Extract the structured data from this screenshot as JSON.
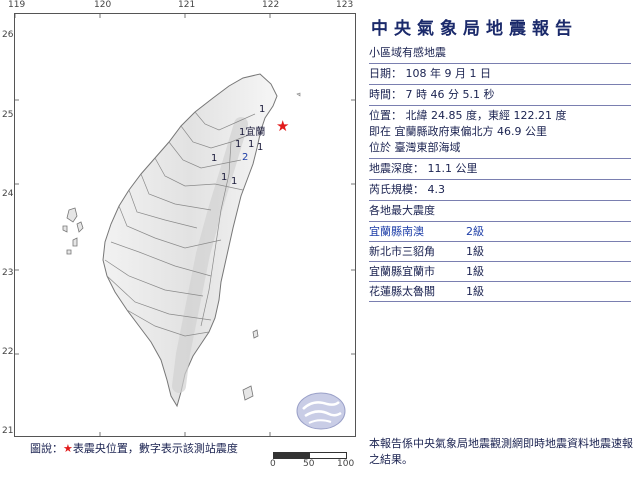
{
  "map": {
    "lon_ticks": [
      "119",
      "120",
      "121",
      "122",
      "123"
    ],
    "lat_ticks": [
      "26",
      "25",
      "24",
      "23",
      "22",
      "21"
    ],
    "epicenter_symbol": "★",
    "station_labels": [
      {
        "text": "1",
        "color": "#1a1a3a"
      },
      {
        "text": "1宜蘭",
        "color": "#1a1a3a"
      },
      {
        "text": "1",
        "color": "#1a1a3a"
      },
      {
        "text": "1",
        "color": "#1a1a3a"
      },
      {
        "text": "1",
        "color": "#1a1a3a"
      },
      {
        "text": "2",
        "color": "#1e3ea8"
      },
      {
        "text": "1",
        "color": "#1a1a3a"
      },
      {
        "text": "1",
        "color": "#1a1a3a"
      },
      {
        "text": "1",
        "color": "#1a1a3a"
      }
    ],
    "scale": {
      "unit": "km",
      "ticks": [
        "0",
        "50",
        "100"
      ]
    }
  },
  "report": {
    "title": "中央氣象局地震報告",
    "type": "小區域有感地震",
    "date": "日期：  108  年  9  月  1  日",
    "time": "時間：  7  時  46  分  5.1  秒",
    "position": "位置：  北緯  24.85  度，東經  122.21  度",
    "located_at": "即在  宜蘭縣政府東偏北方  46.9  公里",
    "region": "位於  臺灣東部海域",
    "depth": "地震深度：  11.1  公里",
    "magnitude": "芮氏規模：  4.3",
    "intensity_header": "各地最大震度",
    "intensities": [
      {
        "station": "宜蘭縣南澳",
        "level": "2級",
        "color": "#1e3ea8"
      },
      {
        "station": "新北市三貂角",
        "level": "1級",
        "color": "#1a2250"
      },
      {
        "station": "宜蘭縣宜蘭市",
        "level": "1級",
        "color": "#1a2250"
      },
      {
        "station": "花蓮縣太魯閣",
        "level": "1級",
        "color": "#1a2250"
      }
    ]
  },
  "legend": {
    "prefix": "圖說：",
    "star": "★",
    "text": "表震央位置，數字表示該測站震度"
  },
  "footnote": "本報告係中央氣象局地震觀測網即時地震資料地震速報之結果。",
  "colors": {
    "land": "#f0f0f0",
    "sea": "#ffffff",
    "epicenter": "#e21b1b",
    "intensity2": "#1e3ea8",
    "intensity1": "#1a1a3a"
  }
}
